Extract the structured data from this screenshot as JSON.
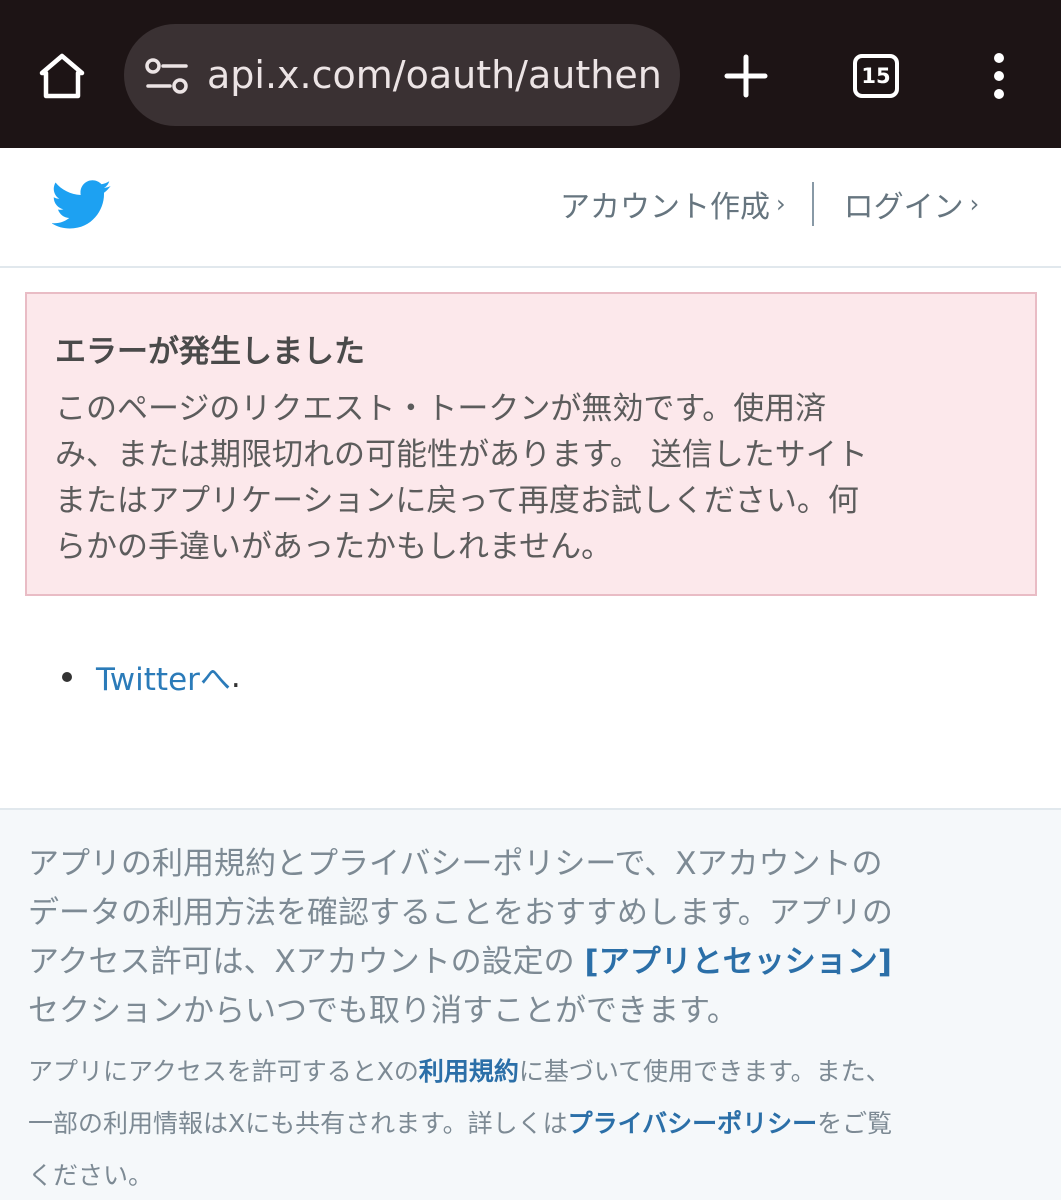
{
  "browser": {
    "url": "api.x.com/oauth/authent",
    "tab_count": "15",
    "icons": [
      "home-icon",
      "site-settings-icon",
      "plus-icon",
      "tabs-icon",
      "more-vert-icon"
    ]
  },
  "header": {
    "logo_icon": "twitter-bird-icon",
    "signup_label": "アカウント作成",
    "login_label": "ログイン",
    "chevron": "›",
    "brand_color": "#1da1f2"
  },
  "error": {
    "title": "エラーが発生しました",
    "body_lines": [
      "このページのリクエスト・トークンが無効です。使用済",
      "み、または期限切れの可能性があります。 送信したサイト",
      "またはアプリケーションに戻って再度お試しください。何",
      "らかの手違いがあったかもしれません。"
    ]
  },
  "links": {
    "twitter_link": "Twitterへ",
    "suffix": "."
  },
  "footer": {
    "line1": "アプリの利用規約とプライバシーポリシーで、Xアカウントの",
    "line2": "データの利用方法を確認することをおすすめします。アプリの",
    "line3_pre": "アクセス許可は、Xアカウントの設定の ",
    "apps_sessions_link": "[アプリとセッション]",
    "line4": "セクションからいつでも取り消すことができます。",
    "small_line1_pre": "アプリにアクセスを許可するとXの",
    "terms_link": "利用規約",
    "small_line1_post": "に基づいて使用できます。また、",
    "small_line2_pre": "一部の利用情報はXにも共有されます。詳しくは",
    "privacy_link": "プライバシーポリシー",
    "small_line2_post": "をご覧",
    "small_line3": "ください。"
  }
}
